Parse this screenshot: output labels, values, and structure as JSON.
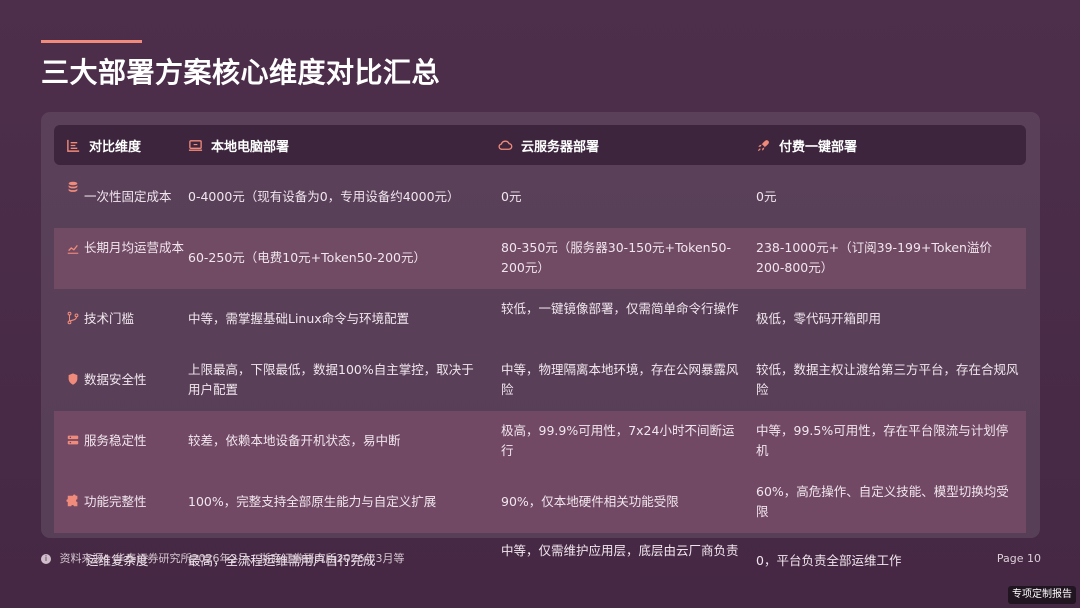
{
  "slide": {
    "title": "三大部署方案核心维度对比汇总",
    "accent_color": "#f08a7a",
    "background_color": "#4a2d48"
  },
  "table": {
    "headers": [
      {
        "label": "对比维度",
        "icon": "list-chart-icon"
      },
      {
        "label": "本地电脑部署",
        "icon": "laptop-icon"
      },
      {
        "label": "云服务器部署",
        "icon": "cloud-icon"
      },
      {
        "label": "付费一键部署",
        "icon": "rocket-icon"
      }
    ],
    "rows": [
      {
        "icon": "coins-icon",
        "dimension": "一次性固定成本",
        "local": "0-4000元（现有设备为0，专用设备约4000元）",
        "cloud": "0元",
        "paid": "0元",
        "style": "plain"
      },
      {
        "icon": "line-chart-icon",
        "dimension": "长期月均运营成本",
        "local": "60-250元（电费10元+Token50-200元）",
        "cloud": "80-350元（服务器30-150元+Token50-200元）",
        "paid": "238-1000元+（订阅39-199+Token溢价200-800元）",
        "style": "pink"
      },
      {
        "icon": "branch-icon",
        "dimension": "技术门槛",
        "local": "中等，需掌握基础Linux命令与环境配置",
        "cloud": "较低，一键镜像部署，仅需简单命令行操作",
        "paid": "极低，零代码开箱即用",
        "style": "plain"
      },
      {
        "icon": "shield-icon",
        "dimension": "数据安全性",
        "local": "上限最高，下限最低，数据100%自主掌控，取决于用户配置",
        "cloud": "中等，物理隔离本地环境，存在公网暴露风险",
        "paid": "较低，数据主权让渡给第三方平台，存在合规风险",
        "style": "plain"
      },
      {
        "icon": "server-icon",
        "dimension": "服务稳定性",
        "local": "较差，依赖本地设备开机状态，易中断",
        "cloud": "极高，99.9%可用性，7x24小时不间断运行",
        "paid": "中等，99.5%可用性，存在平台限流与计划停机",
        "style": "pink"
      },
      {
        "icon": "puzzle-icon",
        "dimension": "功能完整性",
        "local": "100%，完整支持全部原生能力与自定义扩展",
        "cloud": "90%，仅本地硬件相关功能受限",
        "paid": "60%，高危操作、自定义技能、模型切换均受限",
        "style": "pink"
      }
    ],
    "overflow_row": {
      "dimension": "运维复杂度",
      "local": "最高，全流程运维需用户自行完成",
      "cloud": "中等，仅需维护应用层，底层由云厂商负责",
      "paid": "0，平台负责全部运维工作"
    }
  },
  "footer": {
    "source": "资料来源：华泰证券研究所2026年2月、浙商证券研究所2026年3月等",
    "page": "Page 10",
    "tag": "专项定制报告"
  }
}
